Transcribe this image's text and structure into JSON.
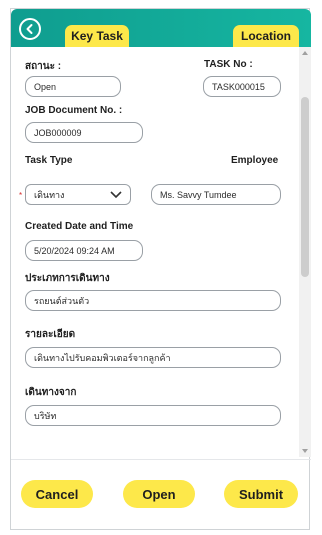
{
  "tabs": {
    "key_task": "Key Task",
    "location": "Location"
  },
  "form": {
    "status_label": "สถานะ :",
    "status_value": "Open",
    "task_no_label": "TASK No :",
    "task_no_value": "TASK000015",
    "job_doc_label": "JOB Document No. :",
    "job_doc_value": "JOB000009",
    "task_type_label": "Task Type",
    "task_type_value": "เดินทาง",
    "employee_label": "Employee",
    "employee_value": "Ms. Savvy Tumdee",
    "created_label": "Created Date and Time",
    "created_value": "5/20/2024  09:24 AM",
    "travel_type_label": "ประเภทการเดินทาง",
    "travel_type_value": "รถยนต์ส่วนตัว",
    "detail_label": "รายละเอียด",
    "detail_value": "เดินทางไปรับคอมพิวเตอร์จากลูกค้า",
    "from_label": "เดินทางจาก",
    "from_value": "บริษัท",
    "required_mark": "*"
  },
  "buttons": {
    "cancel": "Cancel",
    "open": "Open",
    "submit": "Submit"
  },
  "colors": {
    "header_teal": "#16b6a1",
    "accent_yellow": "#fde84a",
    "required_red": "#d62b2b"
  },
  "icons": {
    "back": "back-arrow-icon",
    "dropdown": "chevron-down-icon"
  }
}
